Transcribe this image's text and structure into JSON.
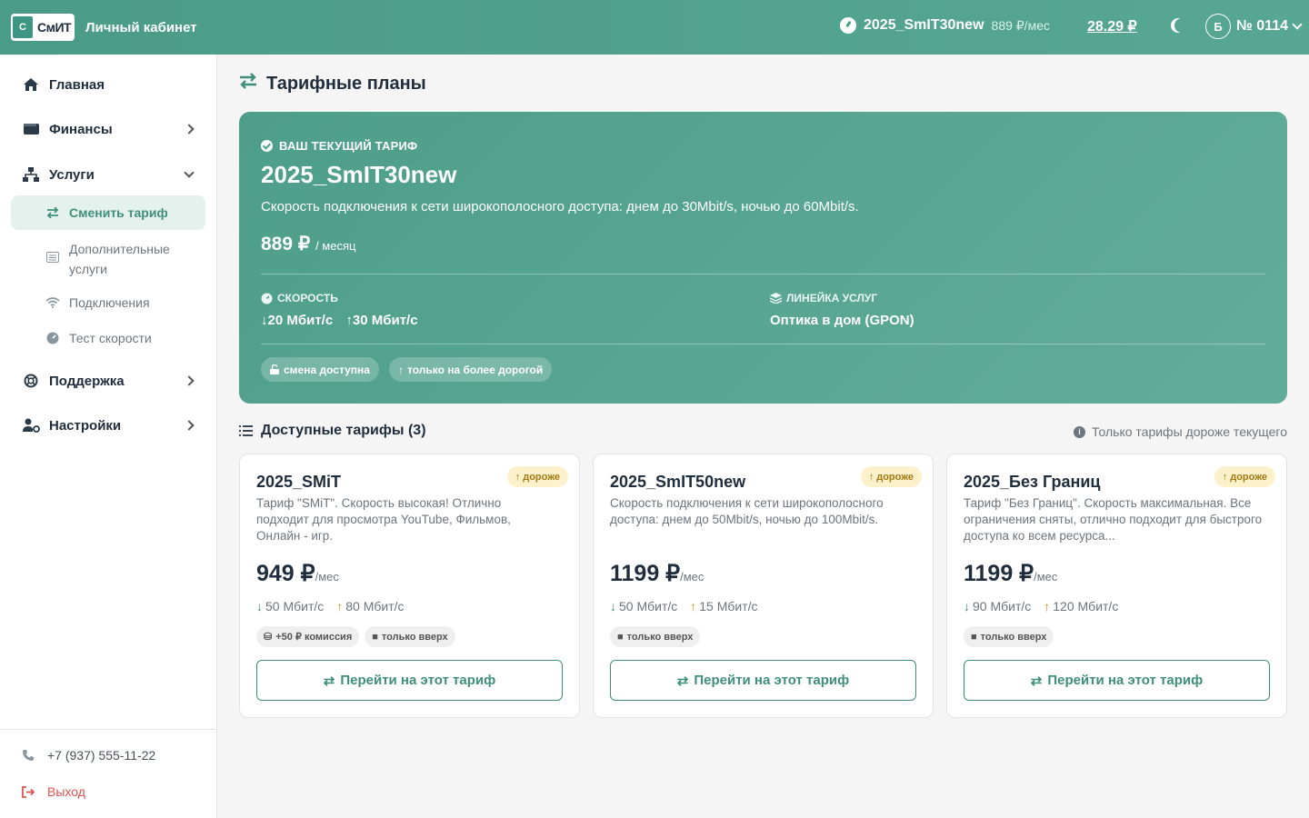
{
  "header": {
    "logo_mark": "С",
    "logo_text": "СмИТ",
    "app_title": "Личный кабинет",
    "tariff_name": "2025_SmIT30new",
    "tariff_price": "889 ₽/мес",
    "balance": "28.29 ₽",
    "avatar_letter": "Б",
    "account": "№ 0114"
  },
  "sidebar": {
    "items": [
      {
        "label": "Главная",
        "icon": "home-icon"
      },
      {
        "label": "Финансы",
        "icon": "wallet-icon"
      },
      {
        "label": "Услуги",
        "icon": "network-icon"
      },
      {
        "label": "Поддержка",
        "icon": "lifebuoy-icon"
      },
      {
        "label": "Настройки",
        "icon": "user-gear-icon"
      }
    ],
    "sub_items": [
      {
        "label": "Сменить тариф",
        "icon": "swap-icon"
      },
      {
        "label": "Дополнительные услуги",
        "icon": "list-icon"
      },
      {
        "label": "Подключения",
        "icon": "wifi-icon"
      },
      {
        "label": "Тест скорости",
        "icon": "gauge-icon"
      }
    ],
    "phone": "+7 (937) 555-11-22",
    "logout": "Выход"
  },
  "page": {
    "title": "Тарифные планы"
  },
  "current": {
    "badge": "ВАШ ТЕКУЩИЙ ТАРИФ",
    "name": "2025_SmIT30new",
    "desc": "Скорость подключения к сети широкополосного доступа: днем до 30Mbit/s, ночью до 60Mbit/s.",
    "price": "889 ₽",
    "price_unit": "/ месяц",
    "speed_label": "СКОРОСТЬ",
    "speed_down": "20 Мбит/с",
    "speed_up": "30 Мбит/с",
    "line_label": "ЛИНЕЙКА УСЛУГ",
    "line_value": "Оптика в дом (GPON)",
    "pill1": "смена доступна",
    "pill2": "только на более дорогой"
  },
  "available": {
    "title": "Доступные тарифы (3)",
    "note": "Только тарифы дороже текущего",
    "cards": [
      {
        "name": "2025_SMiT",
        "badge": "дороже",
        "desc": "Тариф \"SMiT\". Скорость высокая! Отлично подходит для просмотра YouTube, Фильмов, Онлайн - игр.",
        "price": "949 ₽",
        "unit": "/мес",
        "down": "50 Мбит/с",
        "up": "80 Мбит/с",
        "tags": [
          "+50 ₽ комиссия",
          "только вверх"
        ],
        "button": "Перейти на этот тариф"
      },
      {
        "name": "2025_SmIT50new",
        "badge": "дороже",
        "desc": "Скорость подключения к сети широкополосного доступа: днем до 50Mbit/s, ночью до 100Mbit/s.",
        "price": "1199 ₽",
        "unit": "/мес",
        "down": "50 Мбит/с",
        "up": "15 Мбит/с",
        "tags": [
          "только вверх"
        ],
        "button": "Перейти на этот тариф"
      },
      {
        "name": "2025_Без Границ",
        "badge": "дороже",
        "desc": "Тариф \"Без Границ\". Скорость максимальная. Все ограничения сняты, отлично подходит для быстрого доступа ко всем ресурса...",
        "price": "1199 ₽",
        "unit": "/мес",
        "down": "90 Мбит/с",
        "up": "120 Мбит/с",
        "tags": [
          "только вверх"
        ],
        "button": "Перейти на этот тариф"
      }
    ]
  }
}
